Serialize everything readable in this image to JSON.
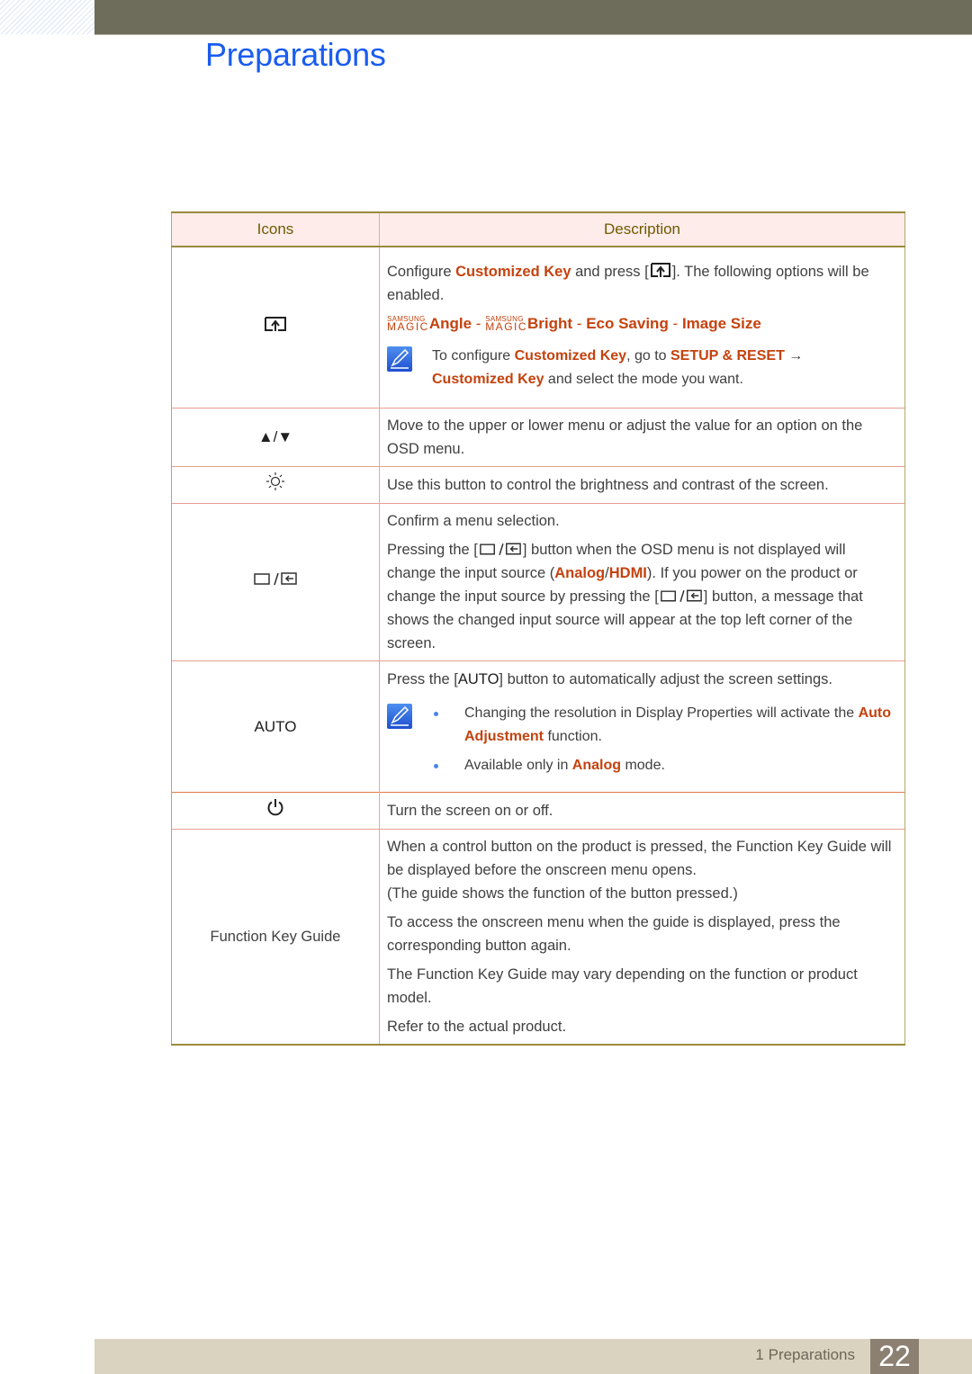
{
  "header": {
    "chapter_title": "Preparations"
  },
  "table": {
    "headers": {
      "icons": "Icons",
      "description": "Description"
    },
    "rows": {
      "customized_key": {
        "icon": "customized-key-icon",
        "p1_a": "Configure ",
        "p1_hl": "Customized Key",
        "p1_b": " and press [",
        "p1_c": "]. The following options will be enabled.",
        "options": {
          "magic_top": "SAMSUNG",
          "magic_bottom": "MAGIC",
          "angle": "Angle",
          "sep": " - ",
          "bright": "Bright",
          "eco": "Eco Saving",
          "image_size": "Image Size"
        },
        "note": {
          "a": "To configure ",
          "hl1": "Customized Key",
          "b": ", go to ",
          "hl2": "SETUP & RESET",
          "arrow": " →",
          "hl3": "Customized Key",
          "c": " and select the mode you want."
        }
      },
      "up_down": {
        "icon": "▲/▼",
        "desc": "Move to the upper or lower menu or adjust the value for an option on the OSD menu."
      },
      "brightness": {
        "icon": "brightness-icon",
        "desc": "Use this button to control the brightness and contrast of the screen."
      },
      "source": {
        "icon": "menu-source-icon",
        "p1": "Confirm a menu selection.",
        "p2_a": "Pressing the [",
        "p2_b": "] button when the OSD menu is not displayed will change the input source (",
        "p2_hl1": "Analog",
        "p2_slash": "/",
        "p2_hl2": "HDMI",
        "p2_c": "). If you power on the product or change the input source by pressing the [",
        "p2_d": "] button, a message that shows the changed input source will appear at the top left corner of the screen."
      },
      "auto": {
        "icon_label": "AUTO",
        "p1_a": "Press the [",
        "p1_key": "AUTO",
        "p1_b": "] button to automatically adjust the screen settings.",
        "bullet1_a": "Changing the resolution in Display Properties will activate the ",
        "bullet1_hl": "Auto Adjustment",
        "bullet1_b": " function.",
        "bullet2_a": "Available only in ",
        "bullet2_hl": "Analog",
        "bullet2_b": " mode."
      },
      "power": {
        "icon": "power-icon",
        "desc": "Turn the screen on or off."
      },
      "function_key_guide": {
        "icon_label": "Function Key Guide",
        "p1": "When a control button on the product is pressed, the Function Key Guide will be displayed before the onscreen menu opens.",
        "p1b": "(The guide shows the function of the button pressed.)",
        "p2": "To access the onscreen menu when the guide is displayed, press the corresponding button again.",
        "p3": "The Function Key Guide may vary depending on the function or product model.",
        "p4": "Refer to the actual product."
      }
    }
  },
  "footer": {
    "section_label": "1 Preparations",
    "page_number": "22"
  },
  "colors": {
    "title_blue": "#1a5cf0",
    "highlight_orange": "#c4420e",
    "header_bar": "#6e6c5a",
    "table_header_bg": "#fdecea",
    "footer_bg": "#d9d3bf",
    "page_badge": "#8c8072"
  }
}
